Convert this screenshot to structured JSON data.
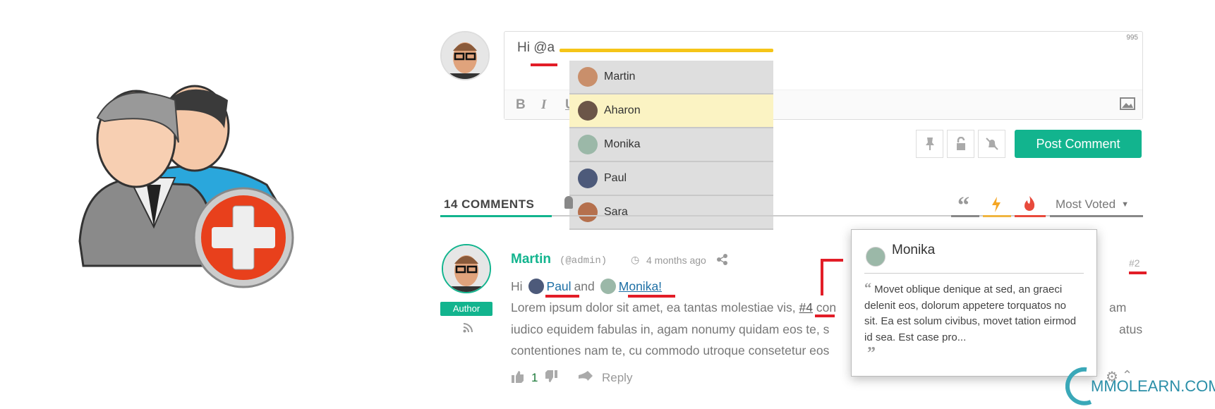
{
  "editor": {
    "text": "Hi @a",
    "char_count": "995",
    "toolbar": {
      "bold": "B",
      "italic": "I",
      "underline": "U"
    }
  },
  "mention_dropdown": {
    "items": [
      {
        "name": "Martin",
        "active": false
      },
      {
        "name": "Aharon",
        "active": true
      },
      {
        "name": "Monika",
        "active": false
      },
      {
        "name": "Paul",
        "active": false
      },
      {
        "name": "Sara",
        "active": false
      }
    ]
  },
  "post_button": "Post Comment",
  "comments_header": {
    "count_label": "14 COMMENTS",
    "sort": "Most Voted"
  },
  "comment": {
    "author": "Martin",
    "handle": "(@admin)",
    "time": "4 months ago",
    "badge": "Author",
    "number": "#2",
    "greeting": "Hi",
    "mention1": "Paul",
    "and": "and",
    "mention2": "Monika!",
    "line1a": "Lorem ipsum dolor sit amet, ea tantas molestiae vis,",
    "ref": "#4",
    "line1b": "con",
    "line1c": "am",
    "line2a": "iudico equidem fabulas in, agam nonumy quidam eos te, s",
    "line2c": "atus",
    "line3a": "contentiones nam te, cu commodo utroque consetetur eos",
    "votes": "1",
    "reply": "Reply"
  },
  "popup": {
    "name": "Monika",
    "text": "Movet oblique denique at sed, an graeci delenit eos, dolorum appetere torquatos no sit. Ea est solum civibus, movet tation eirmod id sea. Est case pro..."
  },
  "watermark": "MMOLEARN.COM",
  "colors": {
    "accent": "#12b48e",
    "link": "#1d6fa5",
    "highlight": "#fbf3c3",
    "annotation_red": "#e21d27",
    "annotation_yellow": "#f5c518"
  }
}
